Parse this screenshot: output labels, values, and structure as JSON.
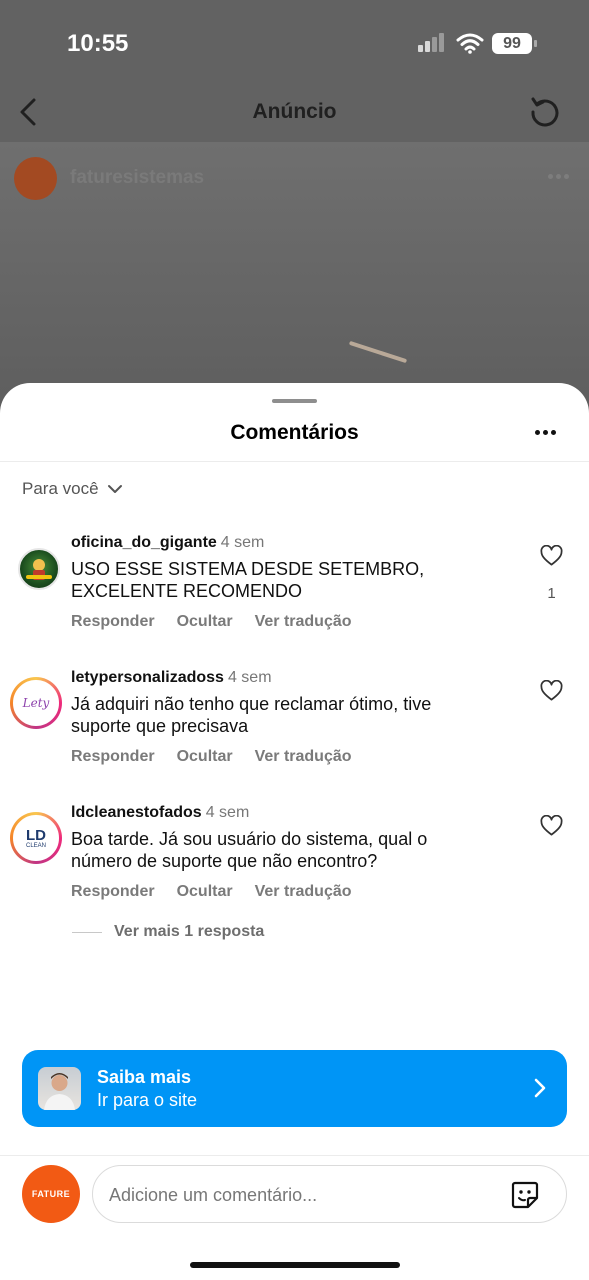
{
  "status_bar": {
    "time": "10:55",
    "battery": "99"
  },
  "nav": {
    "title": "Anúncio"
  },
  "post": {
    "username": "faturesistemas",
    "avatar_text": "FATURE"
  },
  "sheet": {
    "title": "Comentários",
    "sort_label": "Para você"
  },
  "comments": [
    {
      "username": "oficina_do_gigante",
      "time": "4 sem",
      "text": "USO ESSE SISTEMA DESDE SETEMBRO, EXCELENTE RECOMENDO",
      "likes": "1",
      "actions": {
        "reply": "Responder",
        "hide": "Ocultar",
        "translate": "Ver tradução"
      }
    },
    {
      "username": "letypersonalizadoss",
      "time": "4 sem",
      "text": "Já adquiri não tenho que reclamar ótimo, tive suporte que precisava",
      "avatar_text": "Lety",
      "actions": {
        "reply": "Responder",
        "hide": "Ocultar",
        "translate": "Ver tradução"
      }
    },
    {
      "username": "ldcleanestofados",
      "time": "4 sem",
      "text": "Boa tarde. Já sou usuário do sistema, qual o número de suporte que não encontro?",
      "avatar_text": "LD",
      "avatar_subtext": "CLEAN",
      "actions": {
        "reply": "Responder",
        "hide": "Ocultar",
        "translate": "Ver tradução"
      },
      "more_replies": "Ver mais 1 resposta"
    }
  ],
  "cta": {
    "title": "Saiba mais",
    "subtitle": "Ir para o site"
  },
  "composer": {
    "placeholder": "Adicione um comentário...",
    "avatar_text": "FATURE"
  },
  "colors": {
    "accent": "#0095f6",
    "brand": "#f25a14"
  }
}
